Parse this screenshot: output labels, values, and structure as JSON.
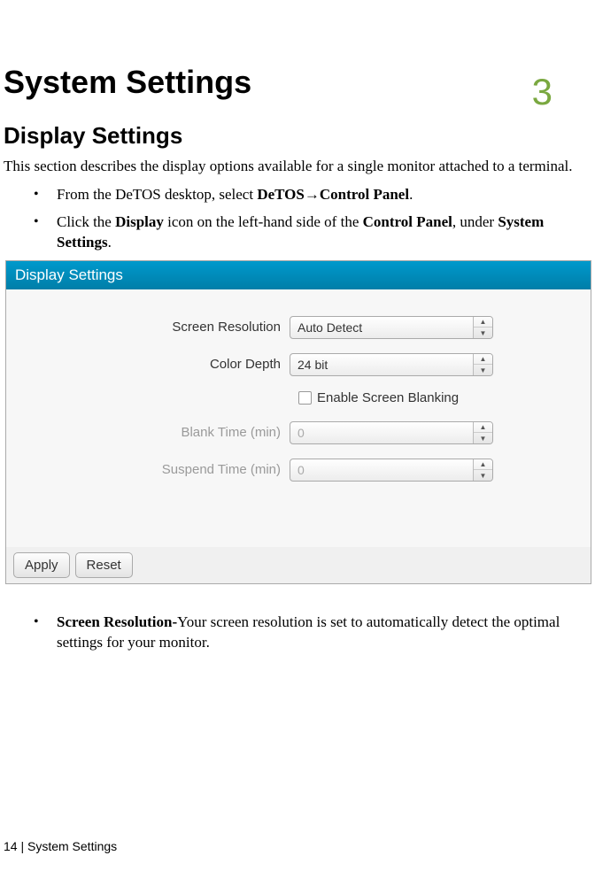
{
  "chapter_number": "3",
  "page_title": "System Settings",
  "section_title": "Display Settings",
  "intro_text": "This section describes the display options available for a single monitor attached to a terminal.",
  "bullets_top": {
    "b1_pre": "From the DeTOS desktop, select ",
    "b1_bold": "DeTOS→Control Panel",
    "b1_post": ".",
    "b2_a": "Click the ",
    "b2_b": "Display",
    "b2_c": " icon on the left-hand side of the ",
    "b2_d": "Control Panel",
    "b2_e": ", under ",
    "b2_f": "System Settings",
    "b2_g": "."
  },
  "dialog": {
    "title": "Display Settings",
    "rows": {
      "screen_res": {
        "label": "Screen Resolution",
        "value": "Auto Detect"
      },
      "color_depth": {
        "label": "Color Depth",
        "value": "24 bit"
      },
      "blank_time": {
        "label": "Blank Time (min)",
        "value": "0"
      },
      "suspend_time": {
        "label": "Suspend Time (min)",
        "value": "0"
      }
    },
    "checkbox_label": "Enable Screen Blanking",
    "apply": "Apply",
    "reset": "Reset"
  },
  "bullets_bottom": {
    "b1_bold": "Screen Resolution-",
    "b1_rest": "Your screen resolution is set to automatically detect the optimal settings for your monitor."
  },
  "footer": "14 | System Settings"
}
